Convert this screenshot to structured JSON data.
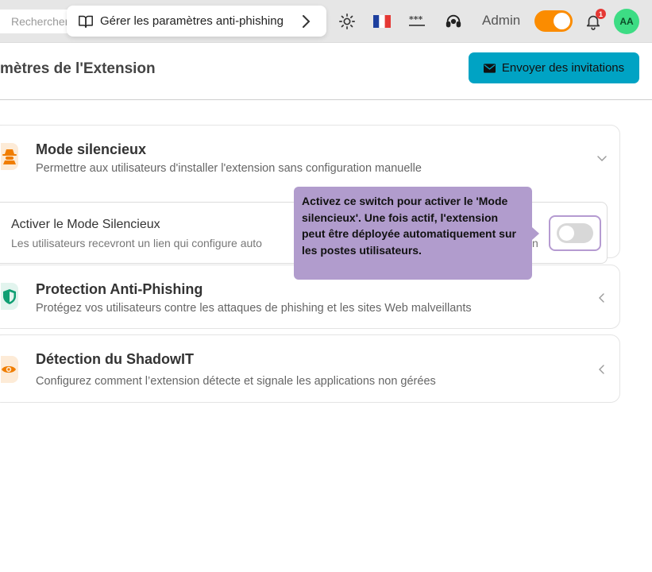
{
  "topbar": {
    "search_placeholder": "Rechercher",
    "guide_label": "Gérer les paramètres anti-phishing",
    "icons": [
      "book-icon",
      "chevron-right-icon",
      "sun-icon",
      "french-flag-icon",
      "password-icon",
      "support-headset-icon",
      "bell-icon"
    ],
    "admin_label": "Admin",
    "admin_toggle_on": true,
    "notification_count": "1",
    "avatar_initials": "AA",
    "colors": {
      "toggle": "#fb8c00",
      "badge": "#e53935",
      "avatar": "#3ddc84"
    }
  },
  "header": {
    "title": "mètres de l'Extension",
    "invite_label": "Envoyer des invitations",
    "invite_color": "#00a3c4"
  },
  "sections": [
    {
      "title": "Mode silencieux",
      "subtitle": "Permettre aux utilisateurs d'installer l'extension sans configuration manuelle",
      "icon": "spy-icon",
      "expanded": true
    },
    {
      "title": "Protection Anti-Phishing",
      "subtitle": "Protégez vos utilisateurs contre les attaques de phishing et les sites Web malveillants",
      "icon": "shield-icon",
      "expanded": false
    },
    {
      "title": "Détection du ShadowIT",
      "subtitle": "Configurez comment l’extension détecte et signale les applications non gérées",
      "icon": "eye-icon",
      "expanded": false
    }
  ],
  "silent_mode": {
    "label": "Activer le Mode Silencieux",
    "description": "Les utilisateurs recevront un lien qui configure auto",
    "description_tail": "n",
    "enabled": false
  },
  "tooltip": {
    "text": "Activez ce switch pour activer le 'Mode silencieux'. Une fois actif, l'extension peut être déployée automatiquement sur les postes utilisateurs.",
    "color": "#b19ccd"
  }
}
